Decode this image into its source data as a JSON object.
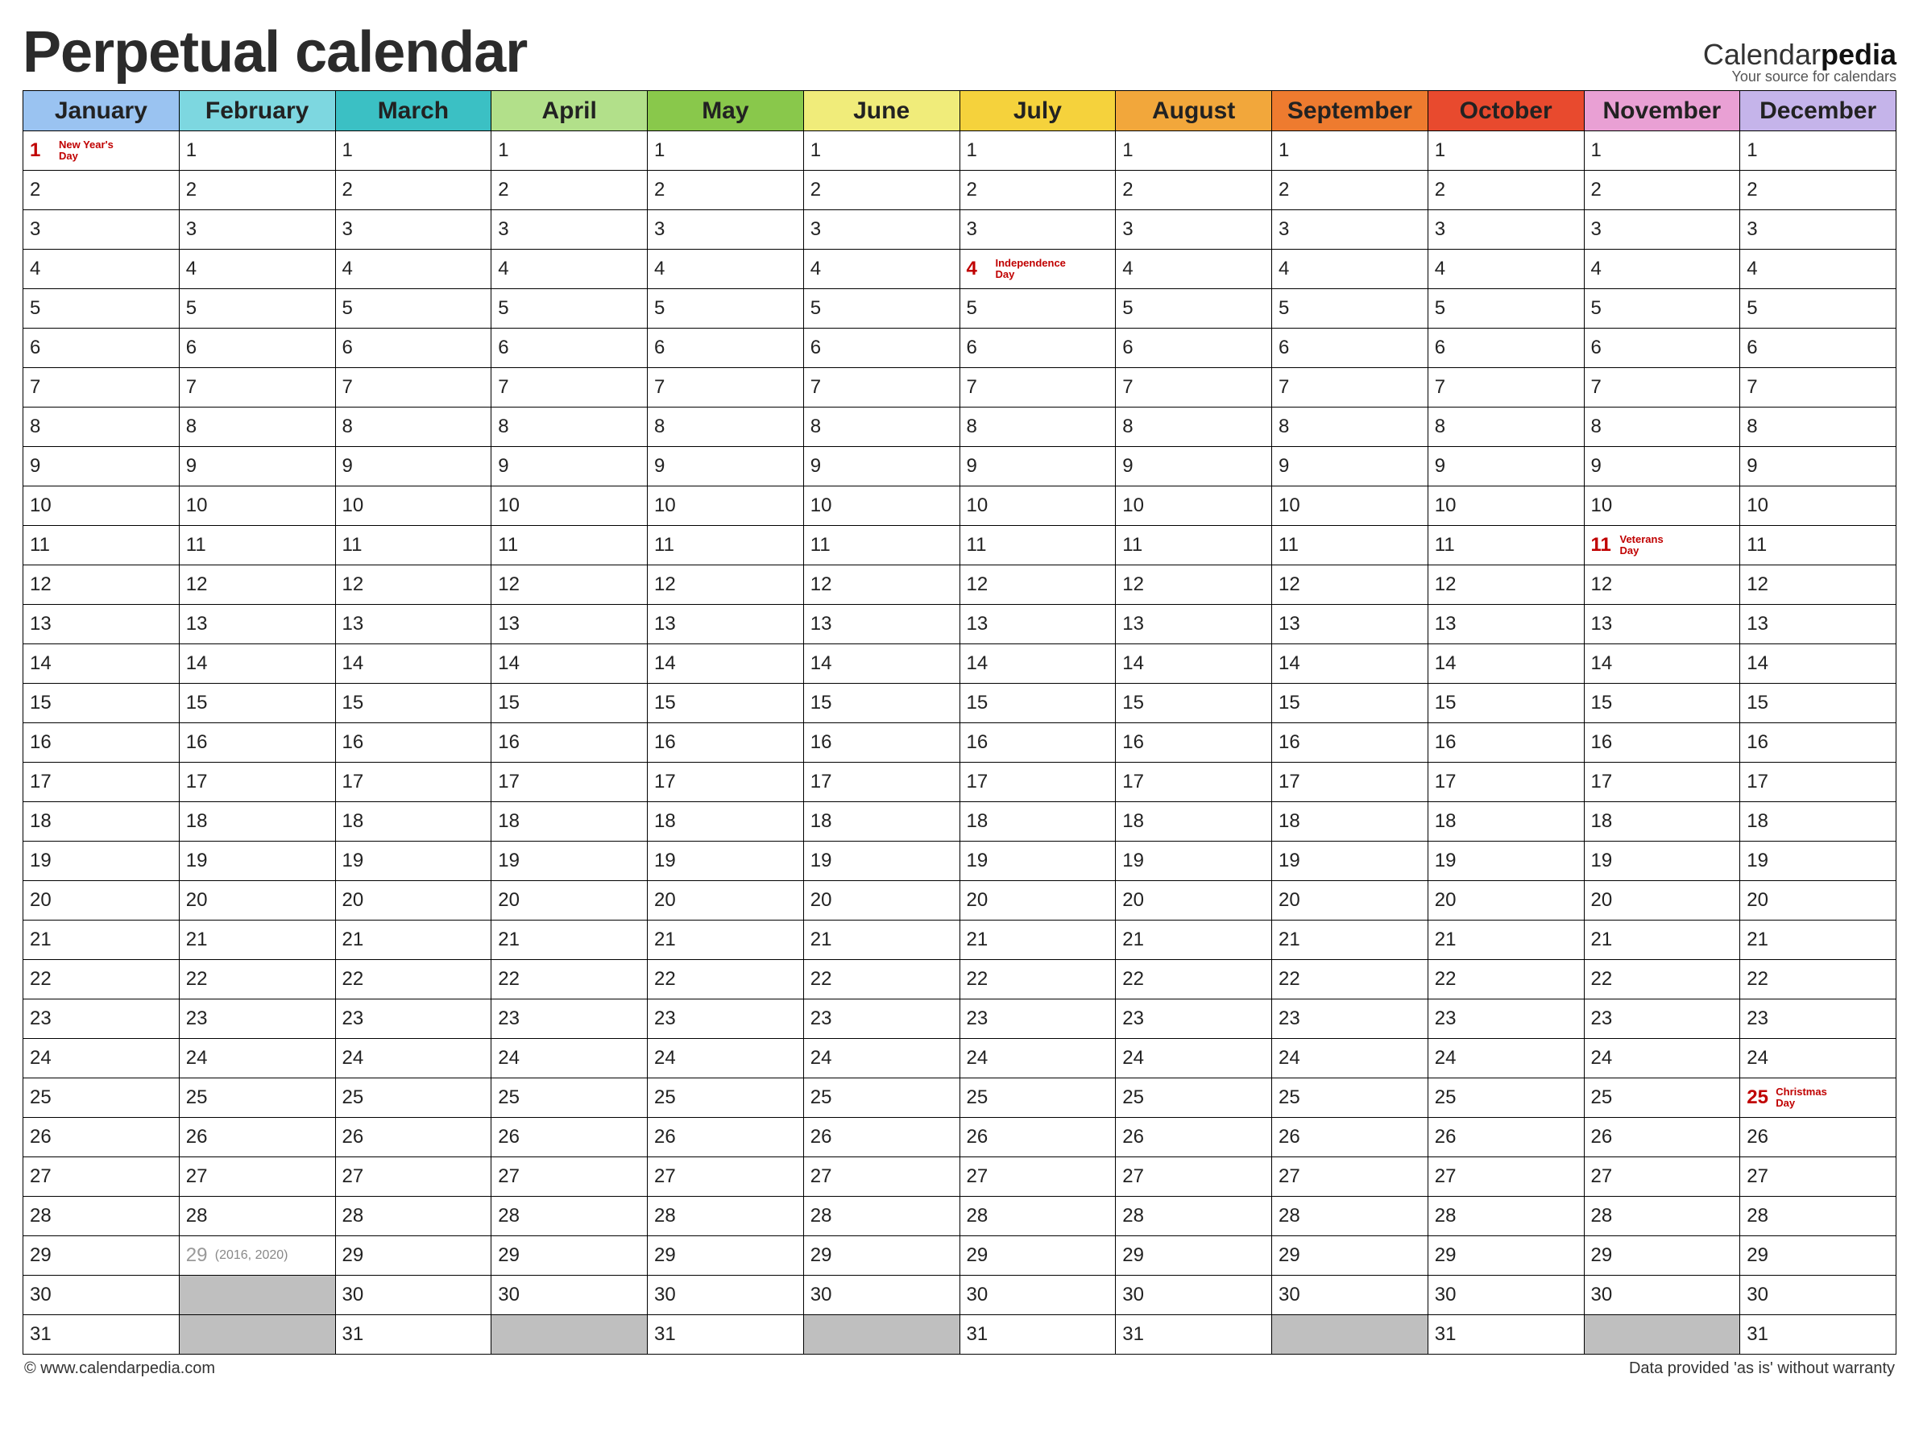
{
  "header": {
    "title": "Perpetual calendar",
    "brand_prefix": "Calendar",
    "brand_suffix": "pedia",
    "brand_tagline": "Your source for calendars"
  },
  "months": [
    {
      "name": "January",
      "color": "#9ac3f1",
      "days": 31
    },
    {
      "name": "February",
      "color": "#7dd7e0",
      "days": 29
    },
    {
      "name": "March",
      "color": "#3bc0c4",
      "days": 31
    },
    {
      "name": "April",
      "color": "#b2e08a",
      "days": 30
    },
    {
      "name": "May",
      "color": "#89c84b",
      "days": 31
    },
    {
      "name": "June",
      "color": "#f0ec7a",
      "days": 30
    },
    {
      "name": "July",
      "color": "#f5d23c",
      "days": 31
    },
    {
      "name": "August",
      "color": "#f2a73b",
      "days": 31
    },
    {
      "name": "September",
      "color": "#ee7b2f",
      "days": 30
    },
    {
      "name": "October",
      "color": "#e84a2e",
      "days": 31
    },
    {
      "name": "November",
      "color": "#e9a0d4",
      "days": 30
    },
    {
      "name": "December",
      "color": "#c5b4ea",
      "days": 31
    }
  ],
  "holidays": {
    "0-1": "New Year's Day",
    "6-4": "Independence Day",
    "10-11": "Veterans Day",
    "11-25": "Christmas Day"
  },
  "leap": {
    "month_index": 1,
    "day": 29,
    "note": "(2016, 2020)"
  },
  "max_day": 31,
  "footer": {
    "left": "© www.calendarpedia.com",
    "right": "Data provided 'as is' without warranty"
  }
}
